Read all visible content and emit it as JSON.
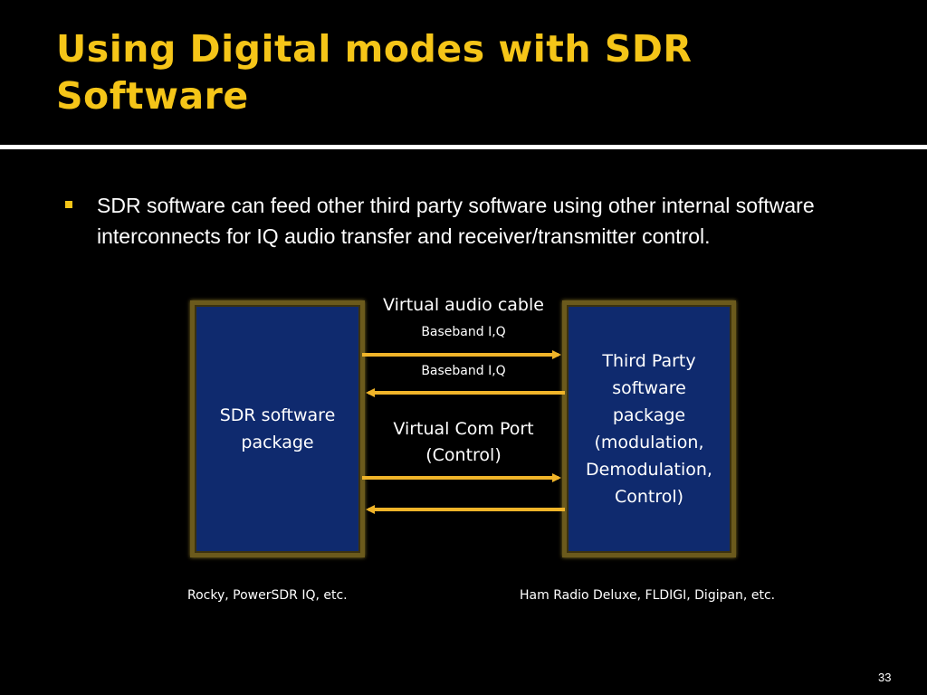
{
  "slide": {
    "title": "Using Digital modes with SDR Software",
    "bullet": "SDR software can feed other third party software using other internal software interconnects for IQ audio transfer and receiver/transmitter control.",
    "page_number": "33",
    "accent_color": "#f5c518"
  },
  "diagram": {
    "left_box": "SDR software\npackage",
    "right_box": "Third Party\nsoftware\npackage\n(modulation,\nDemodulation,\nControl)",
    "virtual_audio_cable": "Virtual audio cable",
    "baseband_1": "Baseband I,Q",
    "baseband_2": "Baseband I,Q",
    "virtual_com_port": "Virtual Com Port\n(Control)",
    "left_caption": "Rocky, PowerSDR IQ, etc.",
    "right_caption": "Ham Radio Deluxe, FLDIGI, Digipan, etc.",
    "box_color": "#0f2a6e",
    "arrow_color": "#f0b429"
  }
}
